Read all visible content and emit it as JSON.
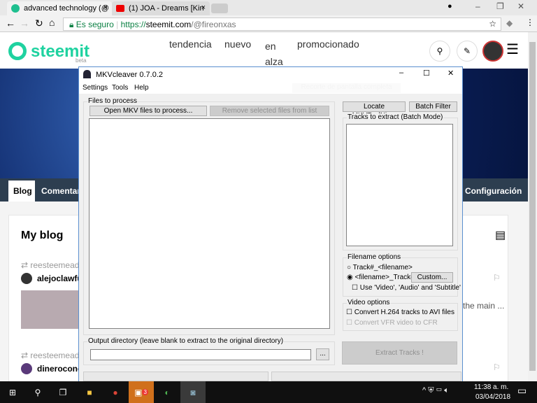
{
  "browser": {
    "tabs": [
      {
        "title": "advanced technology (@"
      },
      {
        "title": "(1) JOA - Dreams [Kin"
      }
    ],
    "secure_label": "Es seguro",
    "url_prefix": "https://",
    "url_domain": "steemit.com",
    "url_path": "/@fireonxas"
  },
  "steemit": {
    "logo": "steemit",
    "beta": "beta",
    "nav": [
      "tendencia",
      "nuevo",
      "en alza",
      "promocionado"
    ],
    "tabs": [
      "Blog",
      "Comentarios",
      "Configuración"
    ],
    "blog_title": "My blog",
    "posts": [
      {
        "resteem": "reesteemeado",
        "author": "alejoclawful",
        "snippet": "the main ..."
      },
      {
        "resteem": "reesteemeado",
        "author": "dinerocono"
      }
    ]
  },
  "dialog": {
    "title": "MKVcleaver 0.7.0.2",
    "menu": [
      "Settings",
      "Tools",
      "Help"
    ],
    "files_group": "Files to process",
    "open_btn": "Open MKV files to process...",
    "remove_btn": "Remove selected files from list",
    "output_group": "Output directory (leave blank to extract to the original directory)",
    "output_value": "",
    "browse_btn": "...",
    "locate_btn": "Locate MKVToolNix...",
    "batch_btn": "Batch Filter",
    "tracks_group": "Tracks to extract (Batch Mode)",
    "filename_group": "Filename options",
    "radio1": "Track#_<filename>",
    "radio2": "<filename>_Track#",
    "custom_btn": "Custom...",
    "use_names": "Use 'Video', 'Audio' and 'Subtitle'",
    "video_group": "Video options",
    "convert_avi": "Convert H.264 tracks to AVI files",
    "convert_vfr": "Convert VFR video to CFR",
    "extract_btn": "Extract Tracks !",
    "overlay_hint": "Recorte de pantalla completa"
  },
  "taskbar": {
    "time": "11:38 a. m.",
    "date": "03/04/2018",
    "badge": "3"
  }
}
